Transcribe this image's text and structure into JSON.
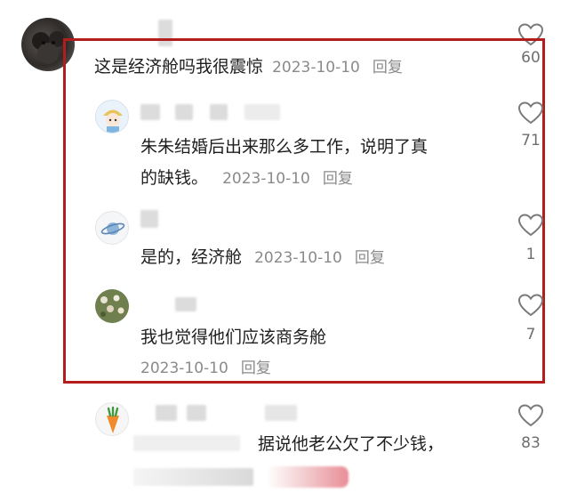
{
  "comments": [
    {
      "id": "c1",
      "text": "这是经济舱吗我很震惊",
      "date": "2023-10-10",
      "reply": "回复",
      "likes": "60"
    },
    {
      "id": "c2",
      "text_line1": "朱朱结婚后出来那么多工作，说明了真",
      "text_line2": "的缺钱。",
      "date": "2023-10-10",
      "reply": "回复",
      "likes": "71"
    },
    {
      "id": "c3",
      "text": "是的，经济舱",
      "date": "2023-10-10",
      "reply": "回复",
      "likes": "1"
    },
    {
      "id": "c4",
      "text": "我也觉得他们应该商务舱",
      "date": "2023-10-10",
      "reply": "回复",
      "likes": "7"
    },
    {
      "id": "c5",
      "text": "据说他老公欠了不少钱，",
      "likes": "83"
    }
  ],
  "colors": {
    "highlight_frame": "#b21e1e",
    "meta_text": "#8a8a8a",
    "like_outline": "#7a7a7a"
  },
  "icons": {
    "like": "heart-outline-icon"
  }
}
